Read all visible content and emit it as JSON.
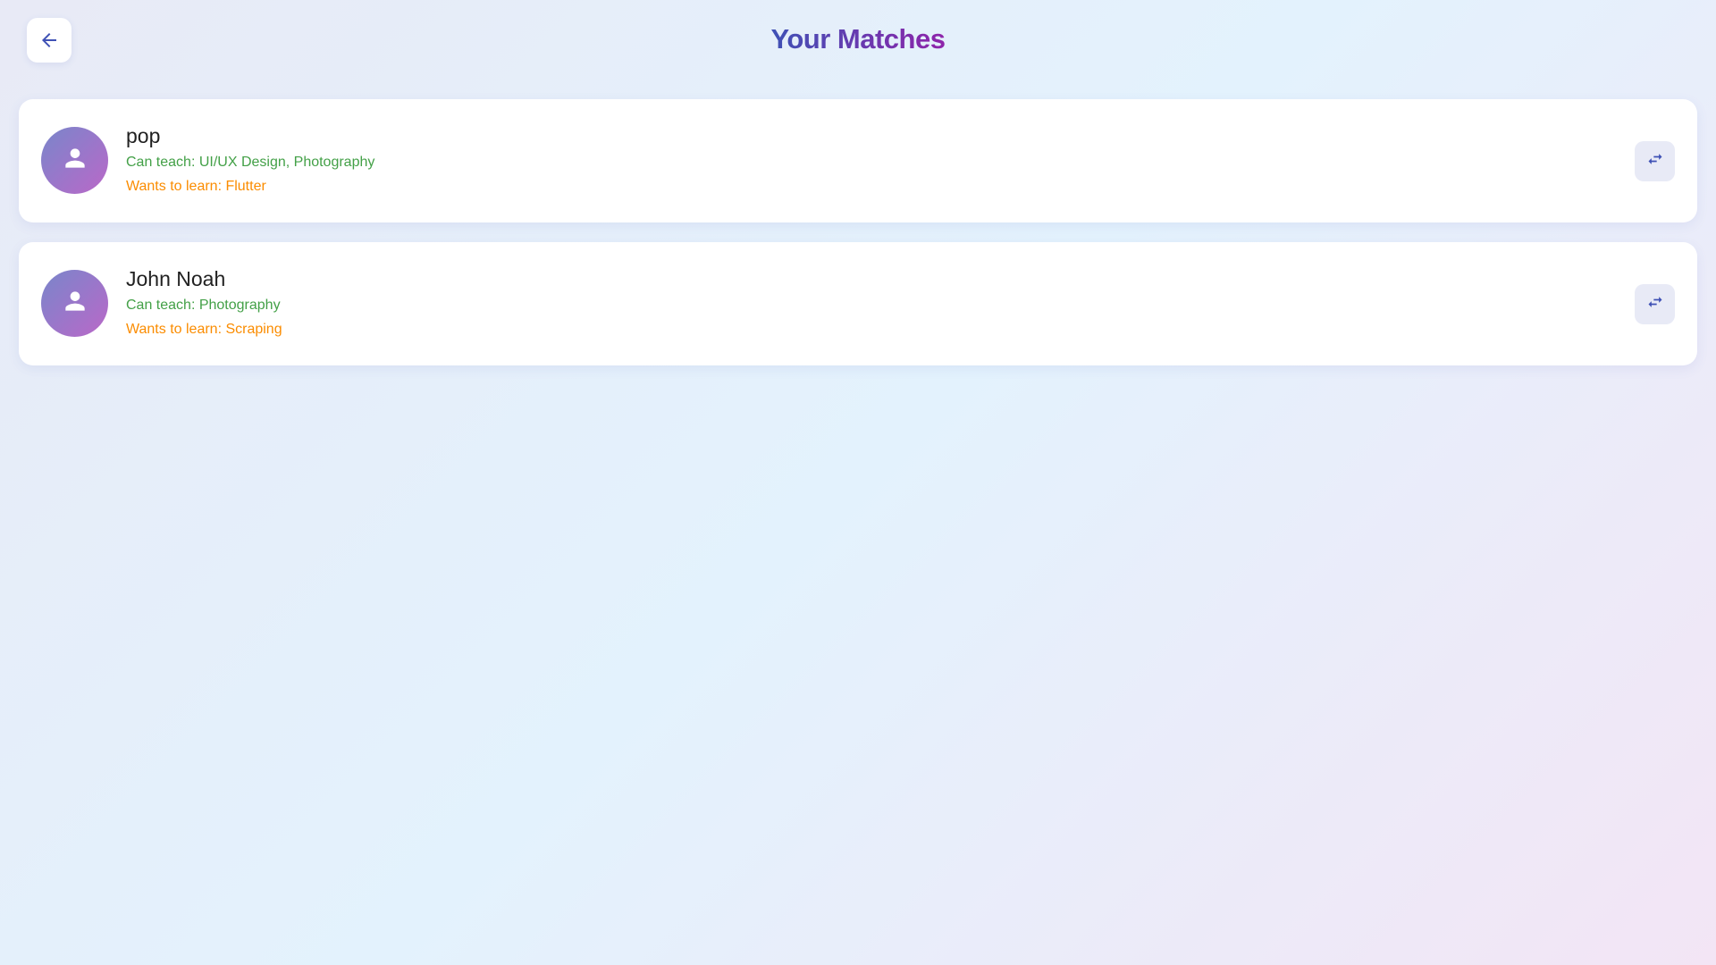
{
  "header": {
    "title": "Your Matches",
    "back_icon": "arrow-left-icon"
  },
  "colors": {
    "accent": "#3f51b5",
    "title_gradient_end": "#8e24aa",
    "teach_text": "#43a047",
    "learn_text": "#fb8c00"
  },
  "matches": [
    {
      "name": "pop",
      "can_teach": "Can teach: UI/UX Design, Photography",
      "wants_to_learn": "Wants to learn: Flutter",
      "avatar_icon": "person-icon",
      "action_icon": "swap-icon"
    },
    {
      "name": "John Noah",
      "can_teach": "Can teach: Photography",
      "wants_to_learn": "Wants to learn: Scraping",
      "avatar_icon": "person-icon",
      "action_icon": "swap-icon"
    }
  ]
}
